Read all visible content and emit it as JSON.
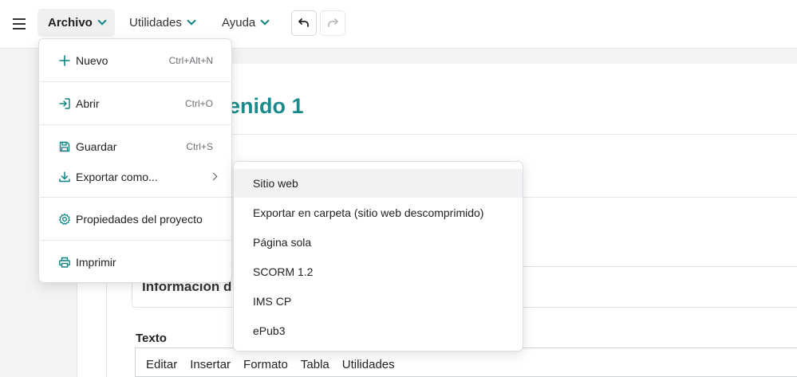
{
  "menubar": {
    "items": [
      {
        "label": "Archivo",
        "active": true
      },
      {
        "label": "Utilidades",
        "active": false
      },
      {
        "label": "Ayuda",
        "active": false
      }
    ]
  },
  "page": {
    "title_visible": "tenido 1",
    "info_title_visible": "Información d",
    "texto_label": "Texto",
    "editor_menu": [
      "Editar",
      "Insertar",
      "Formato",
      "Tabla",
      "Utilidades"
    ]
  },
  "archivo_menu": {
    "nuevo": {
      "label": "Nuevo",
      "shortcut": "Ctrl+Alt+N",
      "icon": "plus-icon"
    },
    "abrir": {
      "label": "Abrir",
      "shortcut": "Ctrl+O",
      "icon": "sign-in-icon"
    },
    "guardar": {
      "label": "Guardar",
      "shortcut": "Ctrl+S",
      "icon": "floppy-disk-icon"
    },
    "exportar": {
      "label": "Exportar como...",
      "icon": "download-icon"
    },
    "propiedades": {
      "label": "Propiedades del proyecto",
      "icon": "gear-icon"
    },
    "imprimir": {
      "label": "Imprimir",
      "icon": "printer-icon"
    }
  },
  "export_submenu": [
    "Sitio web",
    "Exportar en carpeta (sitio web descomprimido)",
    "Página sola",
    "SCORM 1.2",
    "IMS CP",
    "ePub3"
  ],
  "colors": {
    "accent": "#1a8a8a",
    "icon": "#0e8383"
  }
}
